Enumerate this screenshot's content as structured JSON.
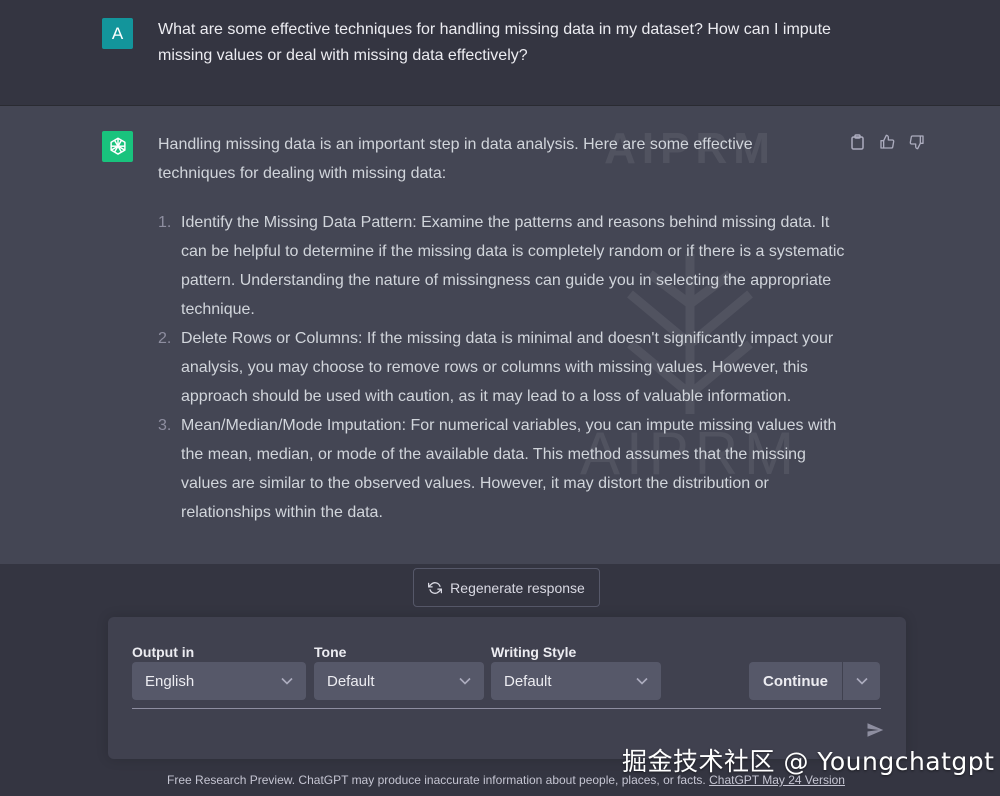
{
  "user_message": {
    "avatar_letter": "A",
    "text": "What are some effective techniques for handling missing data in my dataset? How can I impute missing values or deal with missing data effectively?"
  },
  "assistant_message": {
    "intro": "Handling missing data is an important step in data analysis. Here are some effective techniques for dealing with missing data:",
    "items": [
      {
        "num": "1.",
        "text": "Identify the Missing Data Pattern: Examine the patterns and reasons behind missing data. It can be helpful to determine if the missing data is completely random or if there is a systematic pattern. Understanding the nature of missingness can guide you in selecting the appropriate technique."
      },
      {
        "num": "2.",
        "text": "Delete Rows or Columns: If the missing data is minimal and doesn't significantly impact your analysis, you may choose to remove rows or columns with missing values. However, this approach should be used with caution, as it may lead to a loss of valuable information."
      },
      {
        "num": "3.",
        "text": "Mean/Median/Mode Imputation: For numerical variables, you can impute missing values with the mean, median, or mode of the available data. This method assumes that the missing values are similar to the observed values. However, it may distort the distribution or relationships within the data."
      }
    ],
    "watermark_top": "AIPRM",
    "watermark_bottom": "AIPRM"
  },
  "regenerate": {
    "label": "Regenerate response"
  },
  "composer": {
    "output_in": {
      "label": "Output in",
      "value": "English"
    },
    "tone": {
      "label": "Tone",
      "value": "Default"
    },
    "writing_style": {
      "label": "Writing Style",
      "value": "Default"
    },
    "continue_label": "Continue",
    "prompt_placeholder": ""
  },
  "footer": {
    "text": "Free Research Preview. ChatGPT may produce inaccurate information about people, places, or facts.",
    "link": "ChatGPT May 24 Version"
  },
  "corner_watermark": "掘金技术社区 @ Youngchatgpt",
  "colors": {
    "user_avatar": "#13959b",
    "bot_avatar": "#19c37d",
    "bot_background": "#444654",
    "page_background": "#343541",
    "composer_background": "#40414f",
    "select_background": "#565869"
  }
}
